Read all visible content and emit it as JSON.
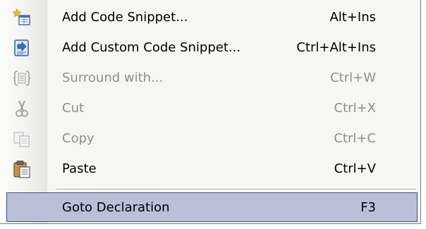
{
  "menu": {
    "items": [
      {
        "label": "Add Code Snippet...",
        "shortcut": "Alt+Ins",
        "icon": "add-snippet-icon",
        "enabled": true
      },
      {
        "label": "Add Custom Code Snippet...",
        "shortcut": "Ctrl+Alt+Ins",
        "icon": "custom-snippet-icon",
        "enabled": true
      },
      {
        "label": "Surround with...",
        "shortcut": "Ctrl+W",
        "icon": "surround-braces-icon",
        "enabled": false
      },
      {
        "label": "Cut",
        "shortcut": "Ctrl+X",
        "icon": "scissors-icon",
        "enabled": false
      },
      {
        "label": "Copy",
        "shortcut": "Ctrl+C",
        "icon": "copy-icon",
        "enabled": false
      },
      {
        "label": "Paste",
        "shortcut": "Ctrl+V",
        "icon": "clipboard-icon",
        "enabled": true
      },
      {
        "label": "Goto Declaration",
        "shortcut": "F3",
        "icon": "",
        "enabled": true,
        "highlighted": true
      }
    ]
  },
  "colors": {
    "menu_background": "#f6f6f4",
    "highlight_background": "#b9c0d8",
    "highlight_border": "#3d4f7e",
    "disabled_text": "#8e8e8e"
  }
}
